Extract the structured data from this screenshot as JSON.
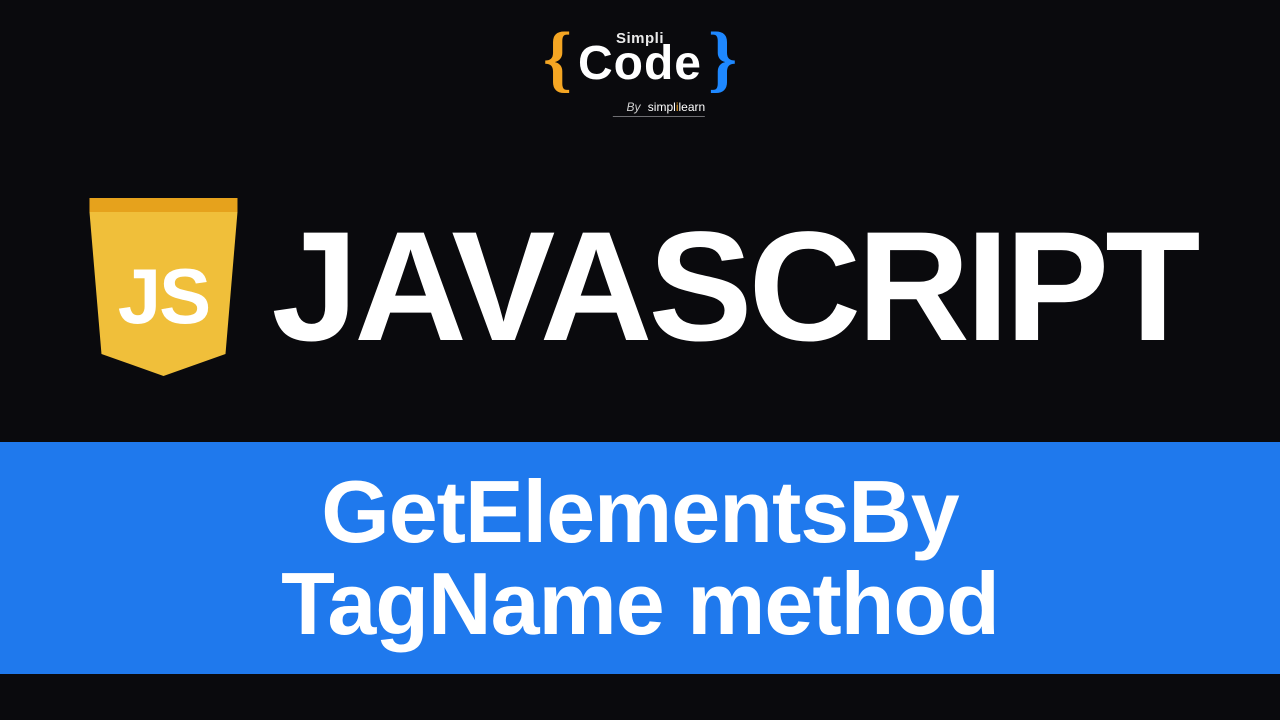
{
  "logo": {
    "brace_open": "{",
    "brace_close": "}",
    "small": "Simpli",
    "big": "Code",
    "byline_by": "By",
    "byline_brand_pre": "simpl",
    "byline_brand_accent": "i",
    "byline_brand_post": "learn"
  },
  "hero": {
    "badge_letters": "JS",
    "title": "JAVASCRIPT"
  },
  "banner": {
    "line1": "GetElementsBy",
    "line2": "TagName method"
  },
  "colors": {
    "background": "#0a0a0d",
    "accent_orange": "#f5a623",
    "accent_blue": "#1e88ff",
    "banner_blue": "#1f79ed",
    "shield_top": "#e6a21c",
    "shield_main": "#f0bf3a",
    "text_white": "#ffffff"
  }
}
